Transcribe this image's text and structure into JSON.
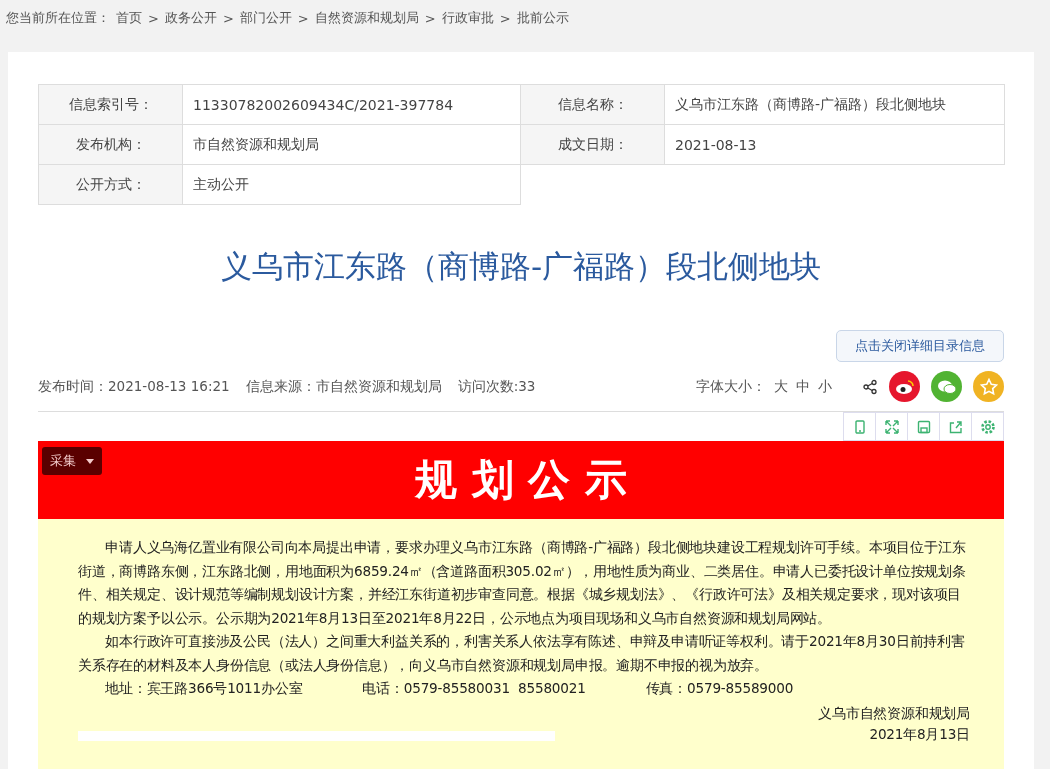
{
  "breadcrumb": {
    "label": "您当前所在位置：",
    "items": [
      "首页",
      "政务公开",
      "部门公开",
      "自然资源和规划局",
      "行政审批",
      "批前公示"
    ],
    "separator": ">"
  },
  "info_table": [
    [
      {
        "label": "信息索引号：",
        "value": "11330782002609434C/2021-397784"
      },
      {
        "label": "信息名称：",
        "value": "义乌市江东路（商博路-广福路）段北侧地块"
      }
    ],
    [
      {
        "label": "发布机构：",
        "value": "市自然资源和规划局"
      },
      {
        "label": "成文日期：",
        "value": "2021-08-13"
      }
    ],
    [
      {
        "label": "公开方式：",
        "value": "主动公开"
      }
    ]
  ],
  "title": "义乌市江东路（商博路-广福路）段北侧地块",
  "toggle_button": "点击关闭详细目录信息",
  "meta": [
    "发布时间：2021-08-13 16:21",
    "信息来源：市自然资源和规划局",
    "访问次数:33"
  ],
  "font_size": {
    "label": "字体大小：",
    "options": [
      "大",
      "中",
      "小"
    ]
  },
  "notice": {
    "collect_button": "采集",
    "heading": "规 划 公 示",
    "paragraphs": [
      "申请人义乌海亿置业有限公司向本局提出申请，要求办理义乌市江东路（商博路-广福路）段北侧地块建设工程规划许可手续。本项目位于江东街道，商博路东侧，江东路北侧，用地面积为6859.24㎡（含道路面积305.02㎡），用地性质为商业、二类居住。申请人已委托设计单位按规划条件、相关规定、设计规范等编制规划设计方案，并经江东街道初步审查同意。根据《城乡规划法》、《行政许可法》及相关规定要求，现对该项目的规划方案予以公示。公示期为2021年8月13日至2021年8月22日，公示地点为项目现场和义乌市自然资源和规划局网站。",
      "如本行政许可直接涉及公民（法人）之间重大利益关系的，利害关系人依法享有陈述、申辩及申请听证等权利。请于2021年8月30日前持利害关系存在的材料及本人身份信息（或法人身份信息），向义乌市自然资源和规划局申报。逾期不申报的视为放弃。"
    ],
    "contacts": [
      "地址：宾王路366号1011办公室",
      "电话：0579-85580031  85580021",
      "传真：0579-85589000"
    ],
    "signature": [
      "义乌市自然资源和规划局",
      "2021年8月13日"
    ]
  }
}
